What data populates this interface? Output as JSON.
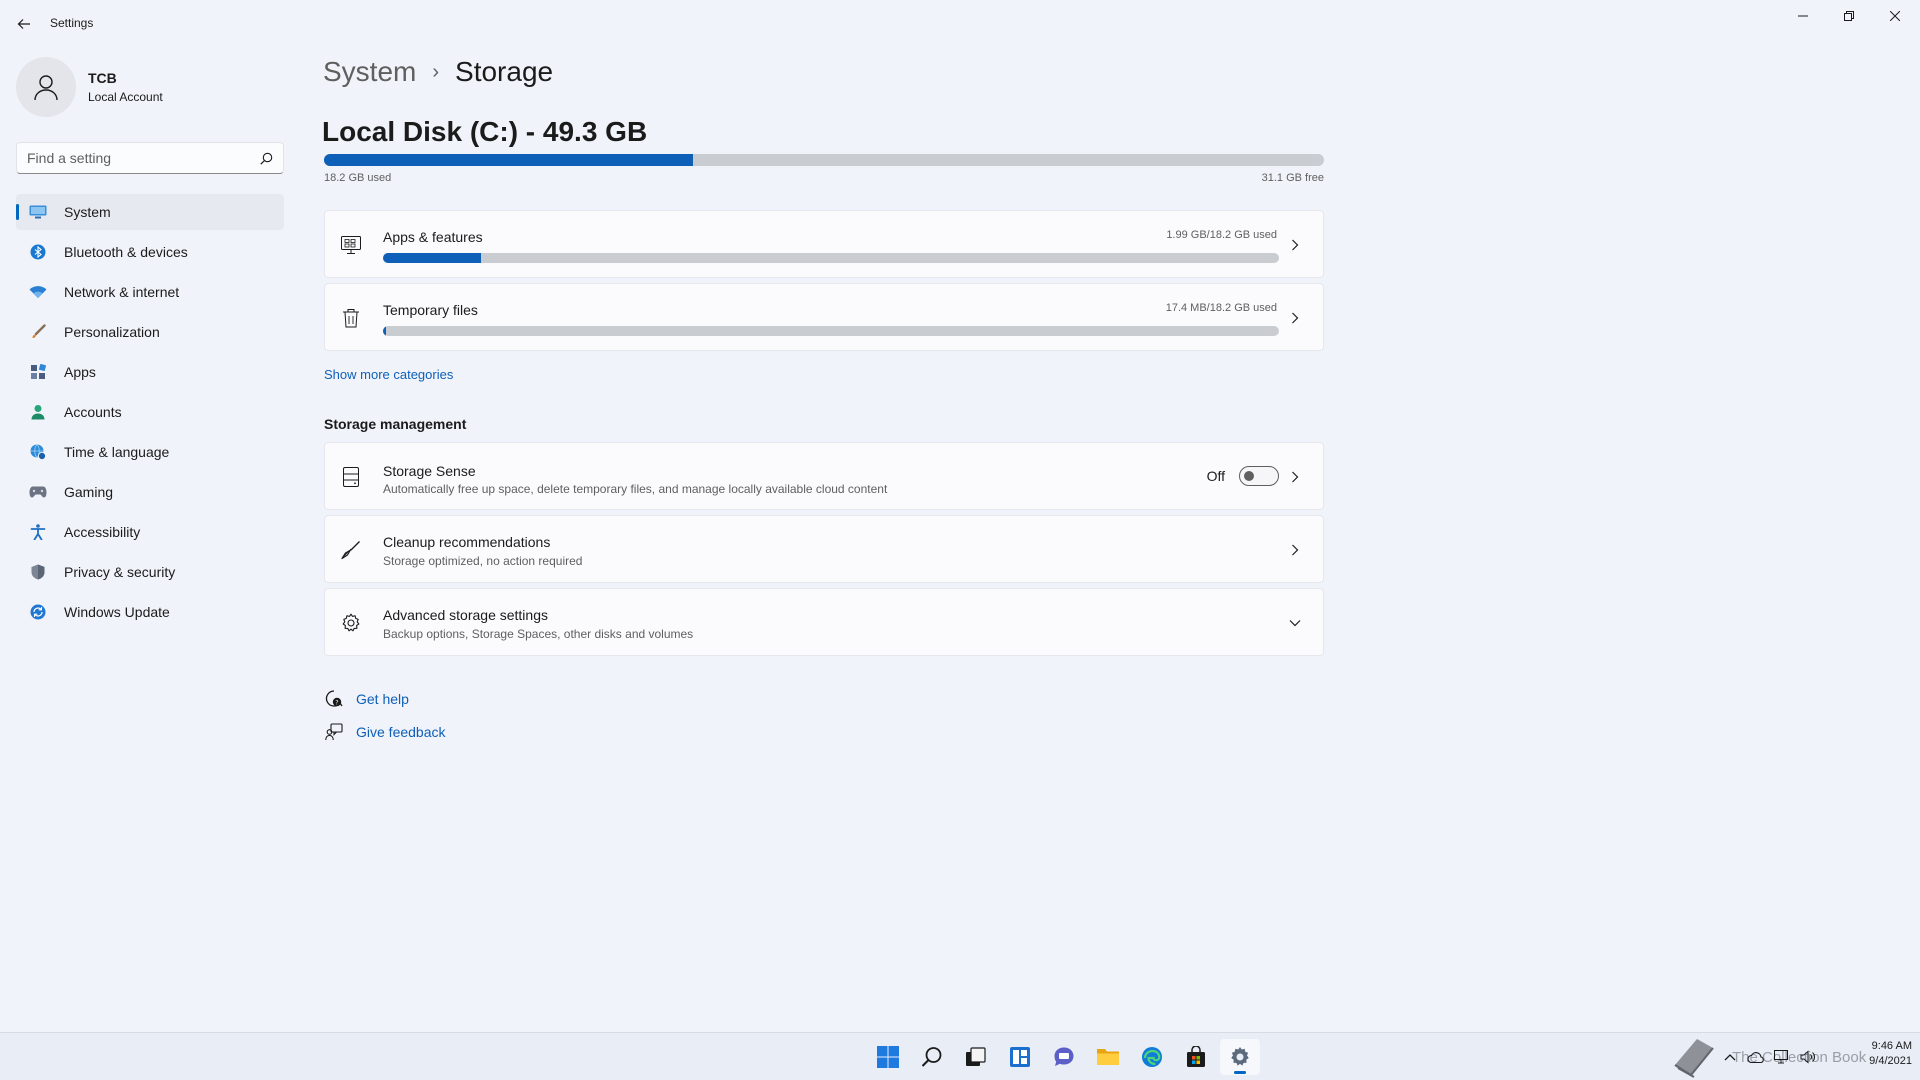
{
  "window": {
    "title": "Settings"
  },
  "profile": {
    "name": "TCB",
    "account_type": "Local Account"
  },
  "search": {
    "placeholder": "Find a setting"
  },
  "sidebar": {
    "items": [
      {
        "label": "System",
        "icon": "monitor-icon",
        "active": true
      },
      {
        "label": "Bluetooth & devices",
        "icon": "bluetooth-icon"
      },
      {
        "label": "Network & internet",
        "icon": "wifi-icon"
      },
      {
        "label": "Personalization",
        "icon": "brush-icon"
      },
      {
        "label": "Apps",
        "icon": "apps-icon"
      },
      {
        "label": "Accounts",
        "icon": "person-icon"
      },
      {
        "label": "Time & language",
        "icon": "globe-clock-icon"
      },
      {
        "label": "Gaming",
        "icon": "gamepad-icon"
      },
      {
        "label": "Accessibility",
        "icon": "accessibility-icon"
      },
      {
        "label": "Privacy & security",
        "icon": "shield-icon"
      },
      {
        "label": "Windows Update",
        "icon": "update-icon"
      }
    ]
  },
  "breadcrumb": {
    "parent": "System",
    "separator": "›",
    "current": "Storage"
  },
  "disk": {
    "title": "Local Disk (C:) - 49.3 GB",
    "used_label": "18.2 GB used",
    "free_label": "31.1 GB free",
    "used_fraction": 0.369
  },
  "categories": [
    {
      "title": "Apps & features",
      "usage": "1.99 GB/18.2 GB used",
      "fraction": 0.109,
      "icon": "apps-features-icon"
    },
    {
      "title": "Temporary files",
      "usage": "17.4 MB/18.2 GB used",
      "fraction": 0.001,
      "icon": "trash-icon"
    }
  ],
  "show_more": "Show more categories",
  "storage_management": {
    "heading": "Storage management",
    "storage_sense": {
      "title": "Storage Sense",
      "subtitle": "Automatically free up space, delete temporary files, and manage locally available cloud content",
      "toggle_label": "Off",
      "toggle_on": false
    },
    "cleanup": {
      "title": "Cleanup recommendations",
      "subtitle": "Storage optimized, no action required"
    },
    "advanced": {
      "title": "Advanced storage settings",
      "subtitle": "Backup options, Storage Spaces, other disks and volumes"
    }
  },
  "help": {
    "get_help": "Get help",
    "give_feedback": "Give feedback"
  },
  "taskbar": {
    "apps": [
      "start-icon",
      "search-icon",
      "task-view-icon",
      "widgets-icon",
      "teams-chat-icon",
      "file-explorer-icon",
      "edge-icon",
      "store-icon",
      "settings-icon"
    ],
    "watermark": "The Collection Book",
    "time": "9:46 AM",
    "date": "9/4/2021"
  },
  "colors": {
    "accent": "#0067c0",
    "bar_fill": "#0e5fb8",
    "bar_track": "#c9ccd1",
    "background": "#f0f3f9"
  }
}
